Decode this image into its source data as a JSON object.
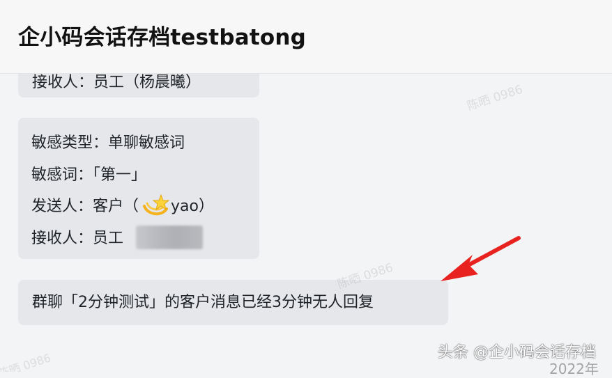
{
  "header": {
    "title": "企小码会话存档testbatong"
  },
  "messages": {
    "partial_line": "接收人：员工（杨晨曦）",
    "alert": {
      "type_line": "敏感类型：单聊敏感词",
      "word_line": "敏感词：「第一」",
      "sender_prefix": "发送人：客户（",
      "sender_emoji": "shooting-star-emoji",
      "sender_suffix": "yao）",
      "receiver_prefix": "接收人：员工"
    },
    "group_notice": "群聊「2分钟测试」的客户消息已经3分钟无人回复"
  },
  "watermarks": {
    "text": "陈晒 0986",
    "text_2": "陈晒 0986",
    "text_3": "陈晒 0986"
  },
  "footer": {
    "source_tag": "头条 @企小码会话存档",
    "corner_date": "2022年"
  },
  "colors": {
    "header_bg": "#f7f7f8",
    "page_bg": "#f3f4f6",
    "bubble_bg": "#e6e7ea",
    "arrow": "#e8231f",
    "text": "#1f2328"
  }
}
